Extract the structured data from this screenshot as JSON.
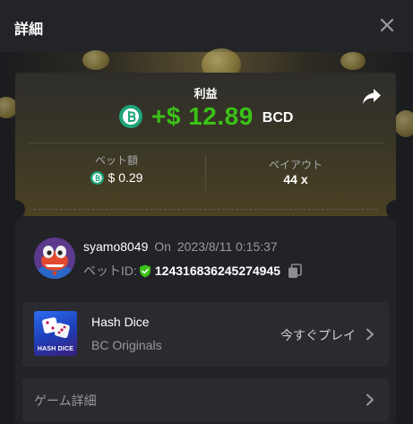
{
  "header": {
    "title": "詳細"
  },
  "profit": {
    "label": "利益",
    "amount": "+$ 12.89",
    "currency": "BCD",
    "color": "#3bc117"
  },
  "stats": {
    "bet_label": "ベット額",
    "bet_value": "$ 0.29",
    "payout_label": "ペイアウト",
    "payout_value": "44 x"
  },
  "user": {
    "name": "syamo8049",
    "on_label": "On",
    "timestamp": "2023/8/11 0:15:37",
    "betid_label": "ベットID:",
    "betid_value": "124316836245274945"
  },
  "game": {
    "name": "Hash Dice",
    "provider": "BC Originals",
    "thumb_text": "HASH DICE",
    "play_label": "今すぐプレイ"
  },
  "details": {
    "label": "ゲーム詳細"
  },
  "icons": {
    "close": "close-icon",
    "share": "share-icon",
    "coin": "bcd-coin-icon",
    "shield": "shield-check-icon",
    "copy": "copy-icon",
    "chevron": "chevron-right-icon"
  }
}
